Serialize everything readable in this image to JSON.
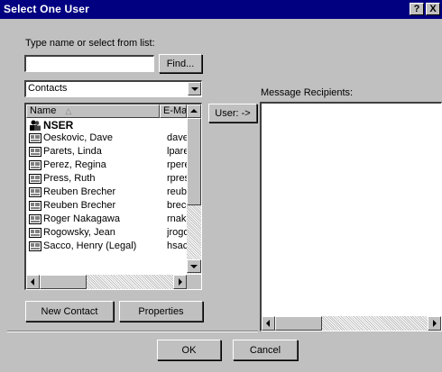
{
  "window": {
    "title": "Select One User",
    "help_label": "?",
    "close_label": "X"
  },
  "search": {
    "label": "Type name or select from list:",
    "value": "",
    "find_label": "Find..."
  },
  "address_book": {
    "selected": "Contacts"
  },
  "list": {
    "columns": [
      "Name",
      "E-Mail"
    ],
    "header_name": "Name",
    "header_email": "E-Ma",
    "sort_indicator": "△",
    "items": [
      {
        "name": "NSER",
        "email": "",
        "icon": "group-icon"
      },
      {
        "name": "Oeskovic, Dave",
        "email": "dave",
        "icon": "contact-card-icon"
      },
      {
        "name": "Parets, Linda",
        "email": "lpare",
        "icon": "contact-card-icon"
      },
      {
        "name": "Perez, Regina",
        "email": "rpere",
        "icon": "contact-card-icon"
      },
      {
        "name": "Press, Ruth",
        "email": "rpres",
        "icon": "contact-card-icon"
      },
      {
        "name": "Reuben Brecher",
        "email": "reube",
        "icon": "contact-card-icon"
      },
      {
        "name": "Reuben Brecher",
        "email": "brecl",
        "icon": "contact-card-icon"
      },
      {
        "name": "Roger Nakagawa",
        "email": "rnaka",
        "icon": "contact-card-icon"
      },
      {
        "name": "Rogowsky, Jean",
        "email": "jrogo",
        "icon": "contact-card-icon"
      },
      {
        "name": "Sacco, Henry (Legal)",
        "email": "hsac",
        "icon": "contact-card-icon"
      }
    ]
  },
  "actions": {
    "user_label": "User: ->",
    "new_contact_label": "New Contact",
    "properties_label": "Properties",
    "ok_label": "OK",
    "cancel_label": "Cancel"
  },
  "recipients": {
    "label": "Message Recipients:"
  }
}
